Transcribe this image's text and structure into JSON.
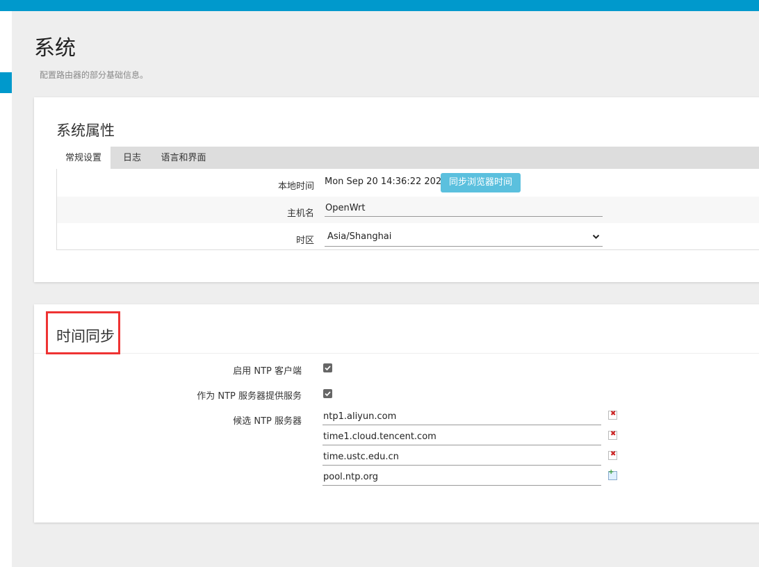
{
  "page": {
    "title": "系统",
    "description": "配置路由器的部分基础信息。"
  },
  "system_props": {
    "title": "系统属性",
    "tabs": [
      "常规设置",
      "日志",
      "语言和界面"
    ],
    "active_tab": "常规设置",
    "local_time_label": "本地时间",
    "local_time_value": "Mon Sep 20 14:36:22 2021",
    "sync_button": "同步浏览器时间",
    "hostname_label": "主机名",
    "hostname_value": "OpenWrt",
    "timezone_label": "时区",
    "timezone_value": "Asia/Shanghai"
  },
  "time_sync": {
    "title": "时间同步",
    "enable_ntp_label": "启用 NTP 客户端",
    "enable_ntp_checked": true,
    "ntp_server_label": "作为 NTP 服务器提供服务",
    "ntp_server_checked": true,
    "candidate_label": "候选 NTP 服务器",
    "servers": [
      "ntp1.aliyun.com",
      "time1.cloud.tencent.com",
      "time.ustc.edu.cn",
      "pool.ntp.org"
    ]
  },
  "colors": {
    "accent": "#0099cc",
    "button": "#5bc0de",
    "highlight": "#ee3333"
  }
}
